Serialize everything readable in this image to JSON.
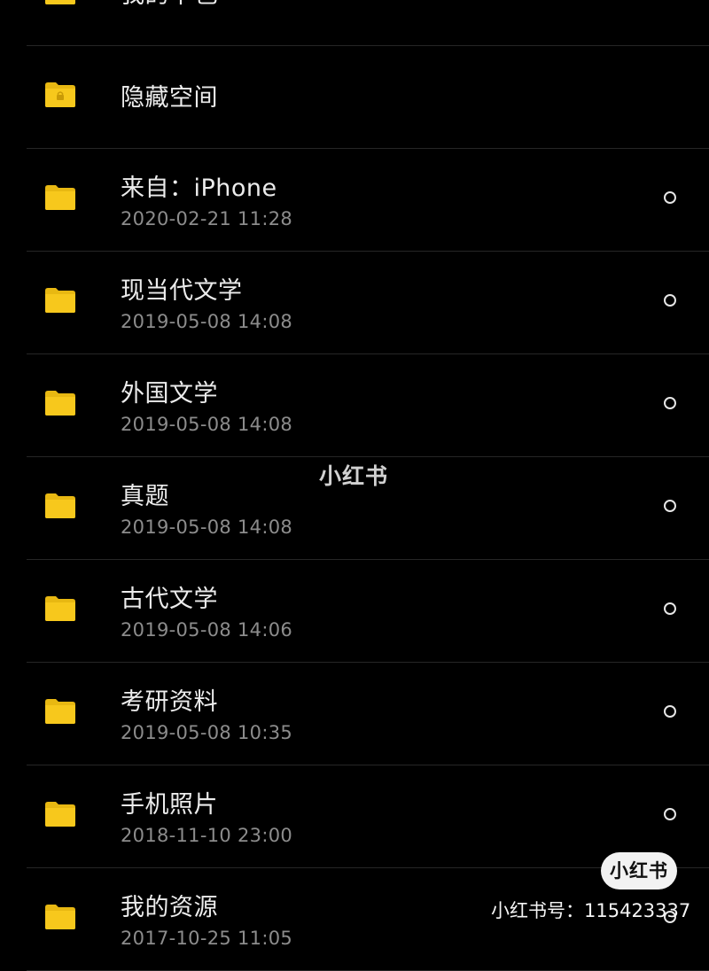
{
  "colors": {
    "background": "#000000",
    "folder": "#f7c81c",
    "folder_tab": "#e8b812",
    "separator": "#262626",
    "name_text": "#ececec",
    "date_text": "#8c8c8c"
  },
  "folders": [
    {
      "name": "我的下包",
      "date": "",
      "icon": "folder-icon",
      "selectable": false
    },
    {
      "name": "隐藏空间",
      "date": "",
      "icon": "locked-folder-icon",
      "selectable": false
    },
    {
      "name": "来自：iPhone",
      "date": "2020-02-21 11:28",
      "icon": "folder-icon",
      "selectable": true
    },
    {
      "name": "现当代文学",
      "date": "2019-05-08 14:08",
      "icon": "folder-icon",
      "selectable": true
    },
    {
      "name": "外国文学",
      "date": "2019-05-08 14:08",
      "icon": "folder-icon",
      "selectable": true
    },
    {
      "name": "真题",
      "date": "2019-05-08 14:08",
      "icon": "folder-icon",
      "selectable": true
    },
    {
      "name": "古代文学",
      "date": "2019-05-08 14:06",
      "icon": "folder-icon",
      "selectable": true
    },
    {
      "name": "考研资料",
      "date": "2019-05-08 10:35",
      "icon": "folder-icon",
      "selectable": true
    },
    {
      "name": "手机照片",
      "date": "2018-11-10 23:00",
      "icon": "folder-icon",
      "selectable": true
    },
    {
      "name": "我的资源",
      "date": "2017-10-25 11:05",
      "icon": "folder-icon",
      "selectable": true
    }
  ],
  "watermark": {
    "center_text": "小红书",
    "badge_text": "小红书",
    "id_text": "小红书号：115423337"
  }
}
